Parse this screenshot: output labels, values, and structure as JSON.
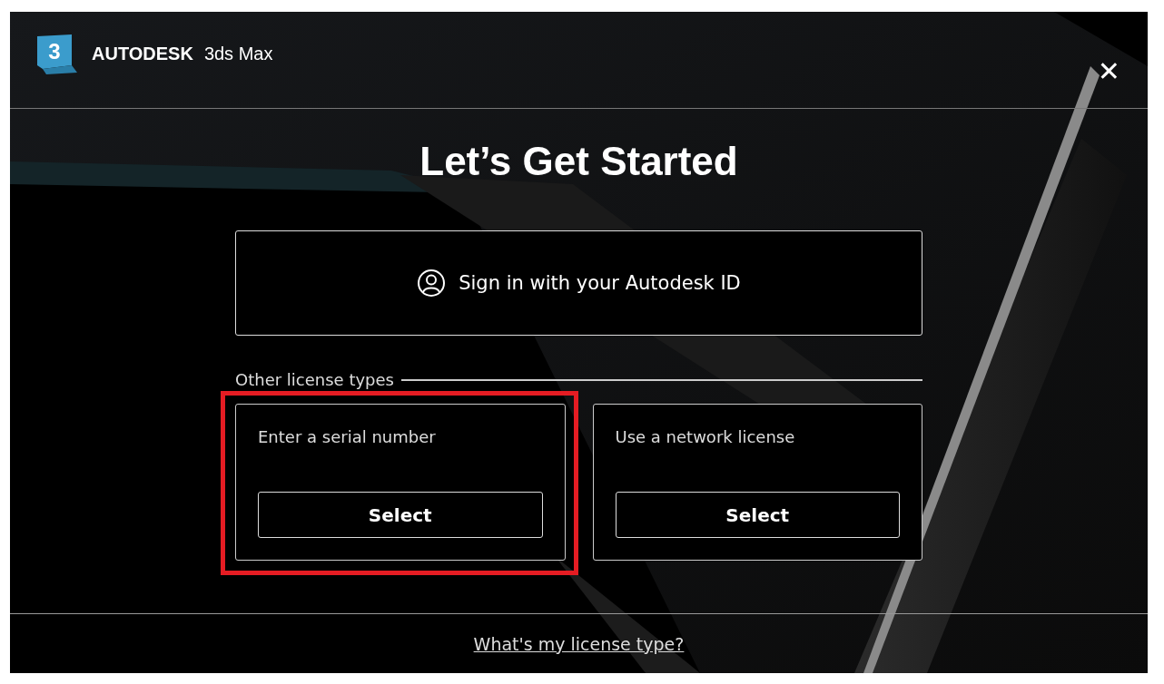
{
  "header": {
    "logo_mark": "3",
    "brand": "AUTODESK",
    "product": "3ds Max",
    "close": "✕"
  },
  "title": "Let’s Get Started",
  "sign_in": {
    "label": "Sign in with your Autodesk ID"
  },
  "other_section": {
    "label": "Other license types"
  },
  "options": [
    {
      "label": "Enter a serial number",
      "button": "Select",
      "highlighted": true
    },
    {
      "label": "Use a network license",
      "button": "Select",
      "highlighted": false
    }
  ],
  "footer": {
    "link": "What's my license type?"
  }
}
